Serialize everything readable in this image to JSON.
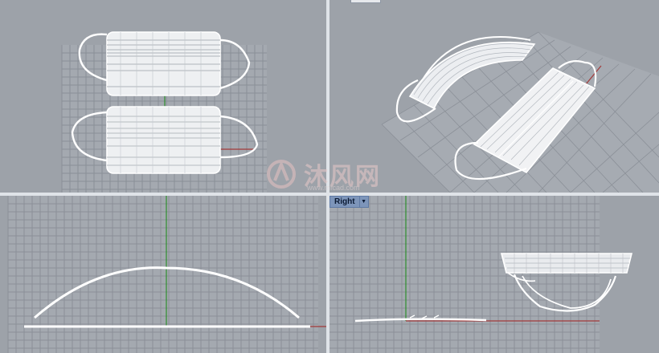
{
  "viewports": {
    "top": {
      "label": ""
    },
    "perspective": {
      "label": ""
    },
    "front": {
      "label": ""
    },
    "right": {
      "label": "Right",
      "menu_icon": "dropdown-arrow-icon"
    }
  },
  "watermark": {
    "text": "沐风网",
    "url": "www.mfcad.com",
    "logo_icon": "mf-logo-icon"
  },
  "colors": {
    "viewport_bg": "#9da2a9",
    "grid_line": "#8b9098",
    "axis_x": "#a23a3a",
    "axis_y": "#2f8f2f",
    "model": "#ffffff",
    "tab_bg": "#7d95ba"
  }
}
